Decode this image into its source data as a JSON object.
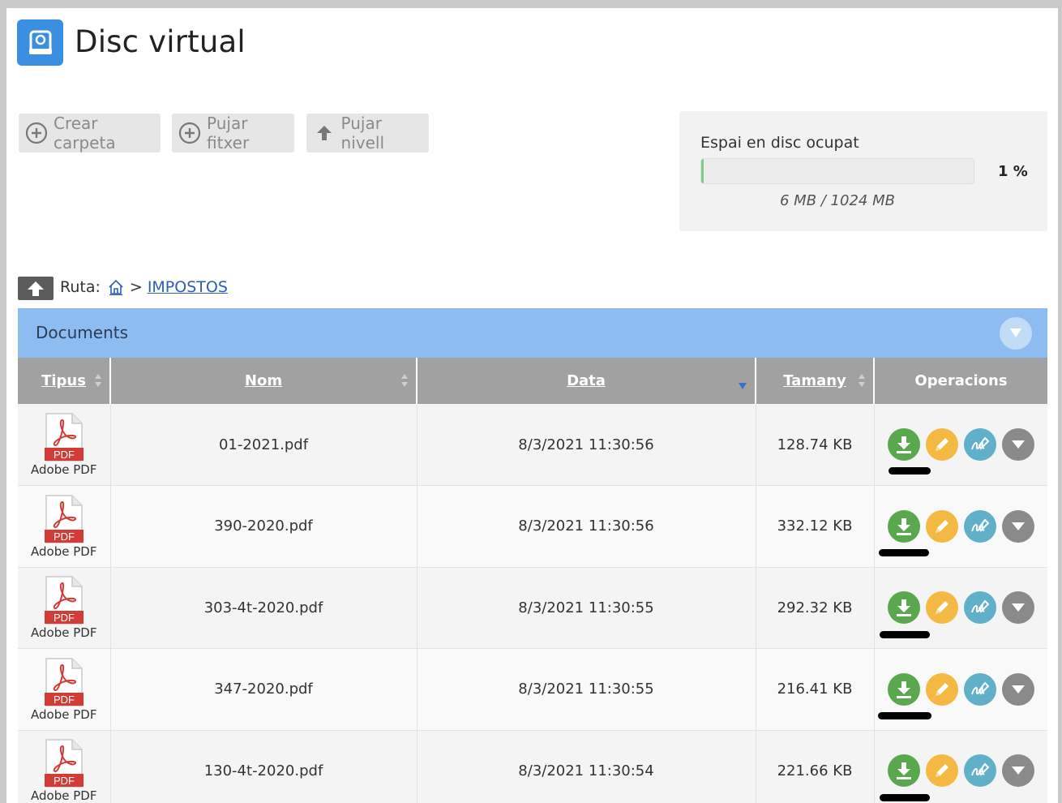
{
  "app": {
    "title": "Disc virtual",
    "logo_icon": "hard-drive-icon",
    "accent": "#3a8fe0"
  },
  "toolbar": {
    "create_folder": "Crear carpeta",
    "upload_file": "Pujar fitxer",
    "upload_level": "Pujar nivell"
  },
  "disk": {
    "title": "Espai en disc ocupat",
    "percent_label": "1 %",
    "percent": 1,
    "usage": "6 MB / 1024 MB"
  },
  "path": {
    "label": "Ruta:",
    "separator": ">",
    "current": "IMPOSTOS"
  },
  "panel": {
    "title": "Documents"
  },
  "table": {
    "columns": [
      "Tipus",
      "Nom",
      "Data",
      "Tamany",
      "Operacions"
    ],
    "rows": [
      {
        "type_badge": "PDF",
        "type_label": "Adobe PDF",
        "name": "01-2021.pdf",
        "date": "8/3/2021 11:30:56",
        "size": "128.74 KB"
      },
      {
        "type_badge": "PDF",
        "type_label": "Adobe PDF",
        "name": "390-2020.pdf",
        "date": "8/3/2021 11:30:56",
        "size": "332.12 KB"
      },
      {
        "type_badge": "PDF",
        "type_label": "Adobe PDF",
        "name": "303-4t-2020.pdf",
        "date": "8/3/2021 11:30:55",
        "size": "292.32 KB"
      },
      {
        "type_badge": "PDF",
        "type_label": "Adobe PDF",
        "name": "347-2020.pdf",
        "date": "8/3/2021 11:30:55",
        "size": "216.41 KB"
      },
      {
        "type_badge": "PDF",
        "type_label": "Adobe PDF",
        "name": "130-4t-2020.pdf",
        "date": "8/3/2021 11:30:54",
        "size": "221.66 KB"
      }
    ]
  },
  "colors": {
    "download": "#5aa84e",
    "edit": "#f4b942",
    "sign": "#5fb0c8",
    "more": "#8a8a8a",
    "panel_header": "#8dbdf0",
    "table_header": "#a1a1a1"
  }
}
